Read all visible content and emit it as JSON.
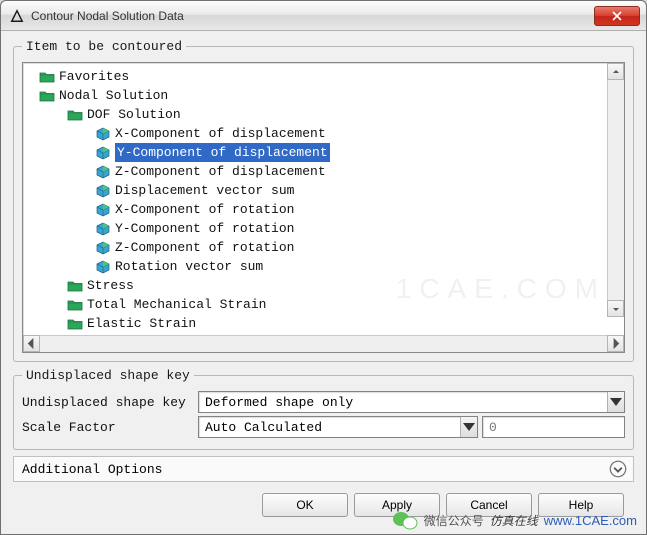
{
  "window": {
    "title": "Contour Nodal Solution Data"
  },
  "groupbox": {
    "tree_legend": "Item to be contoured",
    "shape_legend": "Undisplaced shape key"
  },
  "tree": {
    "nodes": [
      {
        "label": "Favorites",
        "level": 0,
        "type": "folder",
        "selected": false
      },
      {
        "label": "Nodal Solution",
        "level": 0,
        "type": "folder-open",
        "selected": false
      },
      {
        "label": "DOF Solution",
        "level": 1,
        "type": "folder-open",
        "selected": false
      },
      {
        "label": "X-Component of displacement",
        "level": 2,
        "type": "item",
        "selected": false
      },
      {
        "label": "Y-Component of displacement",
        "level": 2,
        "type": "item",
        "selected": true
      },
      {
        "label": "Z-Component of displacement",
        "level": 2,
        "type": "item",
        "selected": false
      },
      {
        "label": "Displacement vector sum",
        "level": 2,
        "type": "item",
        "selected": false
      },
      {
        "label": "X-Component of rotation",
        "level": 2,
        "type": "item",
        "selected": false
      },
      {
        "label": "Y-Component of rotation",
        "level": 2,
        "type": "item",
        "selected": false
      },
      {
        "label": "Z-Component of rotation",
        "level": 2,
        "type": "item",
        "selected": false
      },
      {
        "label": "Rotation vector sum",
        "level": 2,
        "type": "item",
        "selected": false
      },
      {
        "label": "Stress",
        "level": 1,
        "type": "folder",
        "selected": false
      },
      {
        "label": "Total Mechanical Strain",
        "level": 1,
        "type": "folder",
        "selected": false
      },
      {
        "label": "Elastic Strain",
        "level": 1,
        "type": "folder",
        "selected": false
      }
    ]
  },
  "shape": {
    "label_key": "Undisplaced shape key",
    "value_key": "Deformed shape only",
    "label_scale": "Scale Factor",
    "value_scale": "Auto Calculated",
    "value_num": "0"
  },
  "additional": {
    "label": "Additional Options"
  },
  "buttons": {
    "ok": "OK",
    "apply": "Apply",
    "cancel": "Cancel",
    "help": "Help"
  },
  "footer": {
    "wechat_label": "微信公众号",
    "brand": "仿真在线",
    "url": "www.1CAE.com"
  },
  "watermark": "1CAE.COM"
}
